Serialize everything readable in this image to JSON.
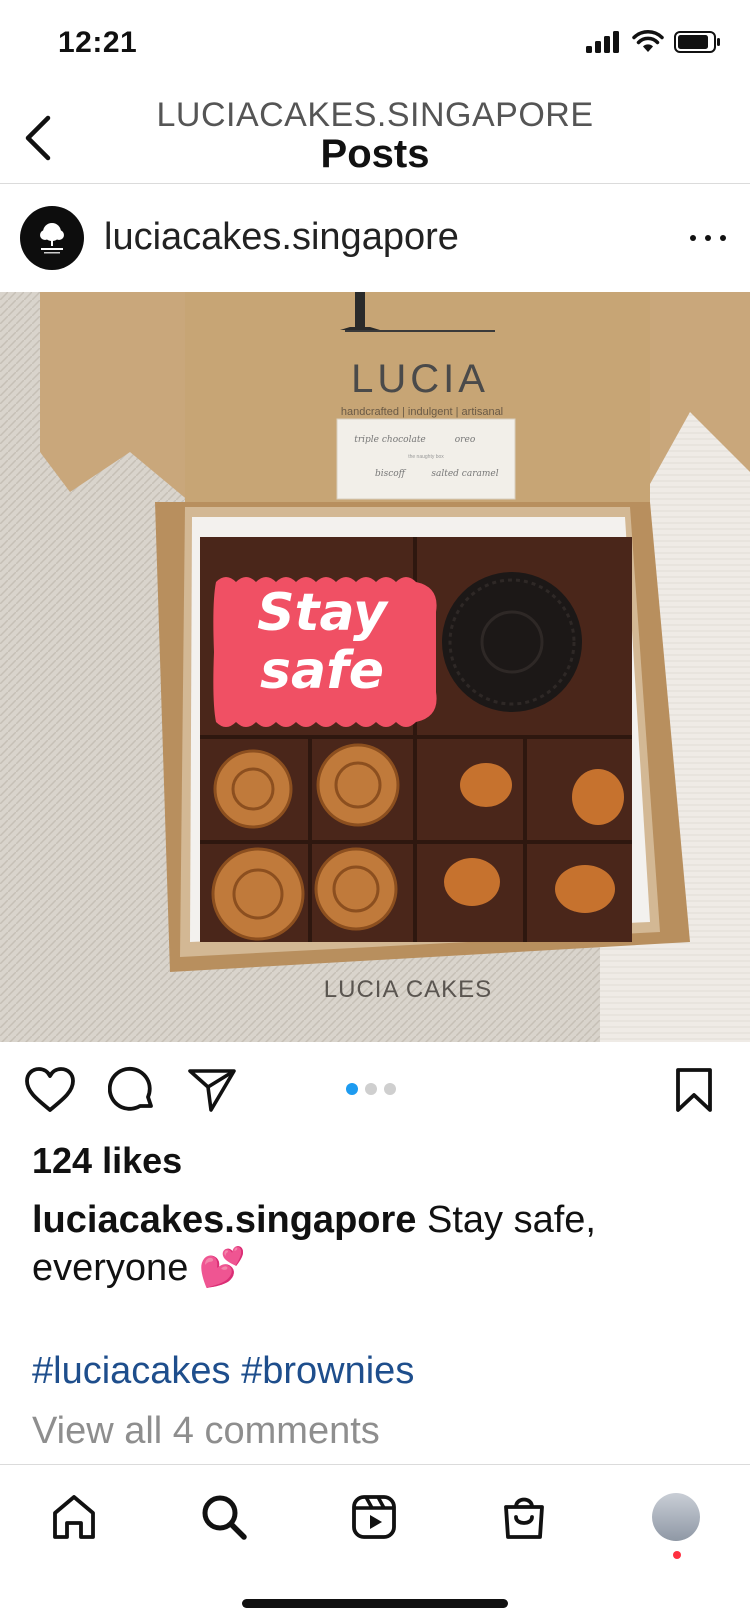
{
  "status_bar": {
    "time": "12:21"
  },
  "header": {
    "subtitle": "LUCIACAKES.SINGAPORE",
    "title": "Posts"
  },
  "post": {
    "username": "luciacakes.singapore",
    "image": {
      "box_brand": "LUCIA",
      "box_tagline": "handcrafted | indulgent | artisanal",
      "label_lines": [
        "triple chocolate",
        "oreo",
        "the naughty box",
        "biscoff",
        "salted caramel"
      ],
      "cookie_text_1": "Stay",
      "cookie_text_2": "safe",
      "watermark": "LUCIA CAKES"
    },
    "carousel": {
      "count": 3,
      "active_index": 0
    },
    "likes": "124 likes",
    "caption_user": "luciacakes.singapore",
    "caption_text": " Stay safe, everyone 💕",
    "hashtags": "#luciacakes #brownies",
    "comments_link": "View all 4 comments"
  },
  "colors": {
    "accent_blue": "#1d9bf0",
    "hashtag": "#1e4e8c",
    "muted": "#8e8e8e",
    "notification": "#ff3040"
  },
  "icons": {
    "status": [
      "signal-icon",
      "wifi-icon",
      "battery-icon"
    ],
    "actions": [
      "heart-icon",
      "comment-icon",
      "share-icon",
      "bookmark-icon"
    ],
    "tabs": [
      "home-icon",
      "search-icon",
      "reels-icon",
      "shop-icon",
      "profile-avatar"
    ]
  }
}
